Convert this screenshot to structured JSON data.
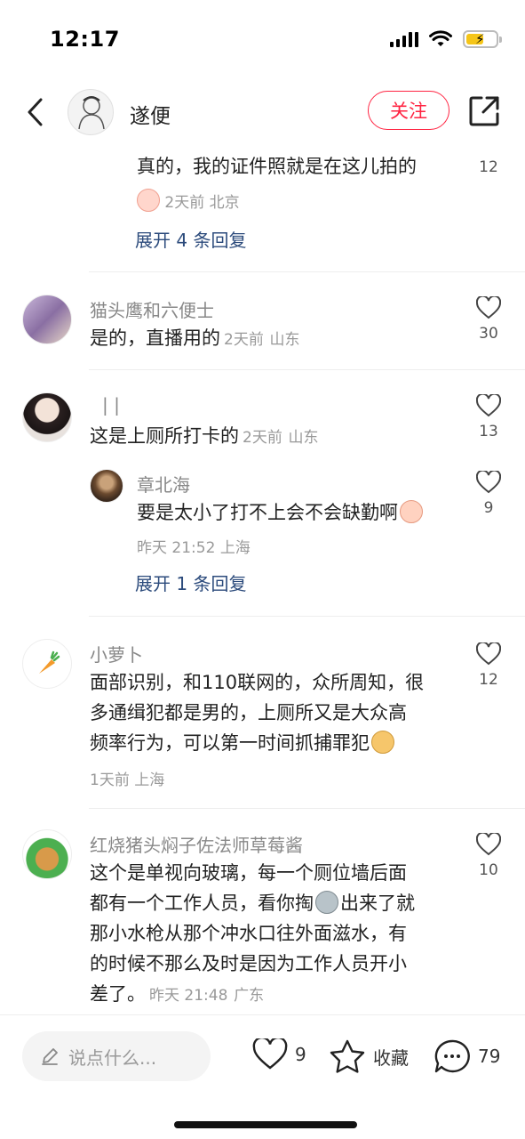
{
  "status": {
    "time": "12:17"
  },
  "header": {
    "username": "遂便",
    "follow_label": "关注"
  },
  "comments": {
    "c0": {
      "text": "真的，我的证件照就是在这儿拍的",
      "time": "2天前",
      "loc": "北京",
      "likes": "12",
      "expand": "展开 4 条回复"
    },
    "c1": {
      "nick": "猫头鹰和六便士",
      "text": "是的，直播用的",
      "time": "2天前",
      "loc": "山东",
      "likes": "30"
    },
    "c2": {
      "nick": "| |",
      "text": "这是上厕所打卡的",
      "time": "2天前",
      "loc": "山东",
      "likes": "13",
      "reply": {
        "nick": "章北海",
        "text": "要是太小了打不上会不会缺勤啊",
        "time": "昨天 21:52",
        "loc": "上海",
        "likes": "9"
      },
      "expand": "展开 1 条回复"
    },
    "c3": {
      "nick": "小萝卜",
      "lines": [
        "面部识别，和110联网的，众所周知，很",
        "多通缉犯都是男的，上厕所又是大众高",
        "频率行为，可以第一时间抓捕罪犯"
      ],
      "time": "1天前",
      "loc": "上海",
      "likes": "12"
    },
    "c4": {
      "nick": "红烧猪头焖子佐法师草莓酱",
      "lines": [
        "这个是单视向玻璃，每一个厕位墙后面",
        "都有一个工作人员，看你掏",
        "那小水枪从那个冲水口往外面滋水，有",
        "的时候不那么及时是因为工作人员开小",
        "差了。"
      ],
      "line2_suffix": "出来了就",
      "time": "昨天 21:48",
      "loc": "广东",
      "likes": "10"
    }
  },
  "bottom": {
    "input_placeholder": "说点什么...",
    "likes": "9",
    "collect_label": "收藏",
    "comments": "79"
  },
  "colors": {
    "accent": "#ff2442",
    "link": "#2c4b7c"
  }
}
